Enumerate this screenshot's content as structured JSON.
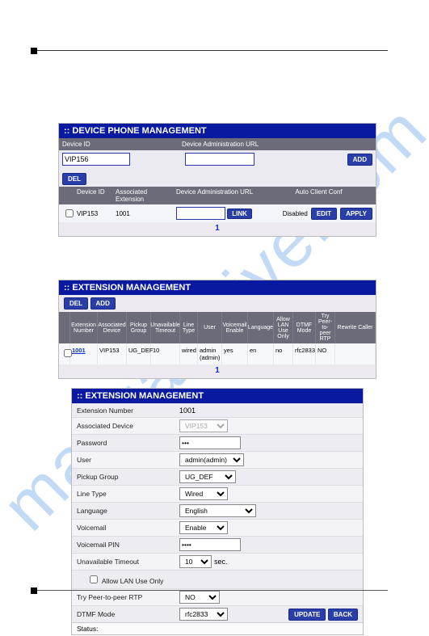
{
  "watermark": "manualshive.com",
  "panel1": {
    "title": ":: DEVICE PHONE MANAGEMENT",
    "hdr_device_id": "Device ID",
    "hdr_admin_url": "Device Administration URL",
    "device_id_value": "VIP156",
    "btn_add": "ADD",
    "btn_del": "DEL",
    "sub_device_id": "Device ID",
    "sub_assoc_ext": "Associated Extension",
    "sub_admin_url": "Device Administration URL",
    "sub_auto": "Auto Client Conf",
    "row_device_id": "VIP153",
    "row_ext": "1001",
    "row_auto": "Disabled",
    "btn_link": "LINK",
    "btn_edit": "EDIT",
    "btn_apply": "APPLY",
    "note": "1"
  },
  "panel2": {
    "title": ":: EXTENSION MANAGEMENT",
    "btn_del": "DEL",
    "btn_add": "ADD",
    "cols": {
      "ext_no": "Extension Number",
      "assoc": "Associated Device",
      "pickup": "Pickup Group",
      "unavail": "Unavailable Timeout",
      "line": "Line Type",
      "user": "User",
      "vmail": "Voicemail Enable",
      "lang": "Language",
      "lan": "Allow LAN Use Only",
      "dtmf": "DTMF Mode",
      "rtp": "Try Peer-to-peer RTP",
      "caller": "Rewrite Caller"
    },
    "row": {
      "ext_no": "1001",
      "assoc": "VIP153",
      "pickup": "UG_DEF",
      "unavail": "10",
      "line": "wired",
      "user": "admin (admin)",
      "vmail": "yes",
      "lang": "en",
      "lan": "no",
      "dtmf": "rfc2833",
      "rtp": "NO",
      "caller": ""
    },
    "note": "1"
  },
  "panel3": {
    "title": ":: EXTENSION MANAGEMENT",
    "labels": {
      "ext_no": "Extension Number",
      "assoc": "Associated Device",
      "password": "Password",
      "user": "User",
      "pickup": "Pickup Group",
      "line": "Line Type",
      "lang": "Language",
      "vmail": "Voicemail",
      "vpin": "Voicemail PIN",
      "unavail": "Unavailable Timeout",
      "lan": "Allow LAN Use Only",
      "rtp": "Try Peer-to-peer RTP",
      "dtmf": "DTMF Mode"
    },
    "values": {
      "ext_no": "1001",
      "assoc": "VIP153",
      "password": "•••",
      "user": "admin(admin)",
      "pickup": "UG_DEF",
      "line": "Wired",
      "lang": "English",
      "vmail": "Enable",
      "vpin": "••••",
      "unavail": "10",
      "unavail_unit": "sec.",
      "rtp": "NO",
      "dtmf": "rfc2833"
    },
    "btn_update": "UPDATE",
    "btn_back": "BACK",
    "status_label": "Status:"
  }
}
